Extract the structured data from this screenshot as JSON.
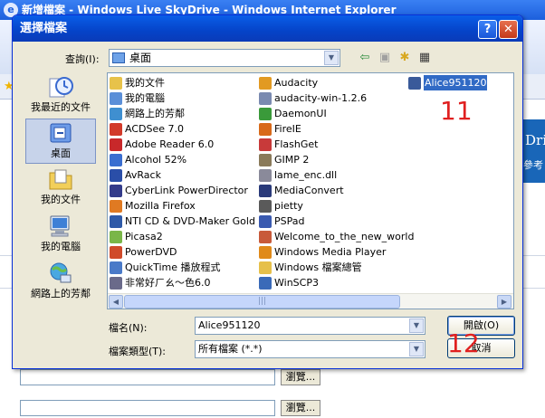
{
  "browser": {
    "title": "新增檔案 - Windows Live SkyDrive - Windows Internet Explorer",
    "banner_text": "Drive",
    "banner_sub": "參考",
    "browse_label": "瀏覽..."
  },
  "dialog": {
    "title": "選擇檔案",
    "help_label": "?",
    "close_label": "✕",
    "look_in_label": "查詢(I):",
    "look_in_value": "桌面",
    "places": [
      {
        "label": "我最近的文件",
        "icon": "recent-documents-icon"
      },
      {
        "label": "桌面",
        "icon": "desktop-icon"
      },
      {
        "label": "我的文件",
        "icon": "my-documents-icon"
      },
      {
        "label": "我的電腦",
        "icon": "my-computer-icon"
      },
      {
        "label": "網路上的芳鄰",
        "icon": "network-places-icon"
      }
    ],
    "files_col1": [
      {
        "name": "我的文件",
        "color": "#e7c24a"
      },
      {
        "name": "我的電腦",
        "color": "#5b8fd8"
      },
      {
        "name": "網路上的芳鄰",
        "color": "#3f8fd0"
      },
      {
        "name": "ACDSee 7.0",
        "color": "#d23a2a"
      },
      {
        "name": "Adobe Reader 6.0",
        "color": "#c8282a"
      },
      {
        "name": "Alcohol 52%",
        "color": "#3a6ed0"
      },
      {
        "name": "AvRack",
        "color": "#2a4ea8"
      },
      {
        "name": "CyberLink PowerDirector",
        "color": "#333b8a"
      },
      {
        "name": "Mozilla Firefox",
        "color": "#e07a22"
      },
      {
        "name": "NTI CD & DVD-Maker Gold",
        "color": "#2f5aa8"
      },
      {
        "name": "Picasa2",
        "color": "#7ab648"
      },
      {
        "name": "PowerDVD",
        "color": "#d04a2a"
      },
      {
        "name": "QuickTime 播放程式",
        "color": "#4a7ac8"
      },
      {
        "name": "非常好ㄏㄠ～色6.0",
        "color": "#6a6a8a"
      }
    ],
    "files_col2": [
      {
        "name": "Audacity",
        "color": "#e29a22"
      },
      {
        "name": "audacity-win-1.2.6",
        "color": "#7a8ab0"
      },
      {
        "name": "DaemonUI",
        "color": "#3a9a3a"
      },
      {
        "name": "FireIE",
        "color": "#d86a1a"
      },
      {
        "name": "FlashGet",
        "color": "#c83a3a"
      },
      {
        "name": "GIMP 2",
        "color": "#8a7a5a"
      },
      {
        "name": "lame_enc.dll",
        "color": "#8a8a9a"
      },
      {
        "name": "MediaConvert",
        "color": "#2a3a7a"
      },
      {
        "name": "pietty",
        "color": "#5a5a5a"
      },
      {
        "name": "PSPad",
        "color": "#3a5ab0"
      },
      {
        "name": "Welcome_to_the_new_world",
        "color": "#c85a3a"
      },
      {
        "name": "Windows Media Player",
        "color": "#e08a1a"
      },
      {
        "name": "Windows 檔案總管",
        "color": "#e6c04a"
      },
      {
        "name": "WinSCP3",
        "color": "#3a6ab8"
      }
    ],
    "files_col3": [
      {
        "name": "Alice951120",
        "color": "#3a5a9a",
        "selected": true
      }
    ],
    "annotation_11": "11",
    "annotation_12": "12",
    "file_name_label": "檔名(N):",
    "file_name_value": "Alice951120",
    "file_type_label": "檔案類型(T):",
    "file_type_value": "所有檔案 (*.*)",
    "open_label": "開啟(O)",
    "cancel_label": "取消"
  }
}
